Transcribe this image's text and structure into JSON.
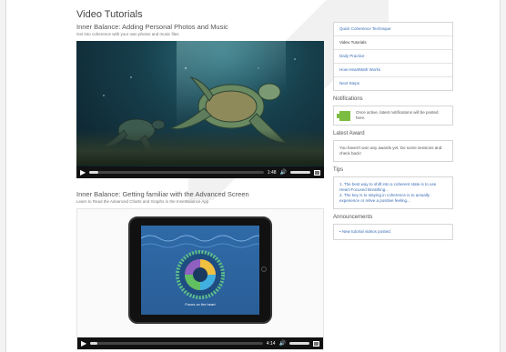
{
  "page": {
    "title": "Video Tutorials"
  },
  "videos": [
    {
      "title": "Inner Balance: Adding Personal Photos and Music",
      "subtitle": "Get into coherence with your own photos and music files",
      "time": "1:48",
      "progress": 0.05
    },
    {
      "title": "Inner Balance: Getting familiar with the Advanced Screen",
      "subtitle": "Learn to Read the Advanced Charts and Graphs in the InnerBalance App",
      "time": "4:14",
      "progress": 0.04,
      "tablet_caption": "Focus on the heart"
    }
  ],
  "sidebar": {
    "nav": [
      {
        "label": "Quick Coherence Technique",
        "active": false
      },
      {
        "label": "Video Tutorials",
        "active": true
      },
      {
        "label": "Daily Practice",
        "active": false
      },
      {
        "label": "How HeartMath Works",
        "active": false
      },
      {
        "label": "Next Steps",
        "active": false
      }
    ],
    "notifications": {
      "heading": "Notifications",
      "text": "Once active, latest notifications will be posted here."
    },
    "award": {
      "heading": "Latest Award",
      "text": "You haven't won any awards yet. Do some sessions and check back!"
    },
    "tips": {
      "heading": "Tips",
      "items": [
        "1.  The best way to shift into a coherent state is to use Heart-Focused Breathing...",
        "2.  The key is to staying in coherence is to actually experience or relive a positive feeling..."
      ]
    },
    "announcements": {
      "heading": "Announcements",
      "items": [
        "•  New tutorial videos posted."
      ]
    }
  },
  "icons": {
    "play": "play-icon",
    "volume": "volume-icon",
    "fullscreen": "fullscreen-icon",
    "notification": "puzzle-icon"
  },
  "colors": {
    "link": "#3a6db5",
    "accent": "#7bbd42"
  }
}
